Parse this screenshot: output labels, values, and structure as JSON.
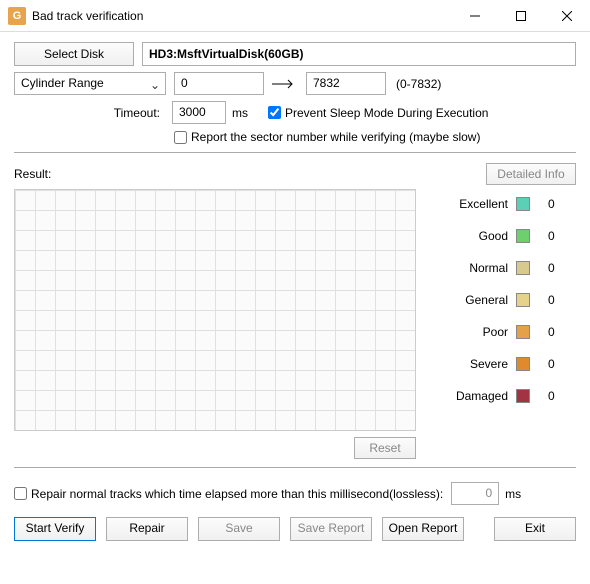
{
  "window": {
    "title": "Bad track verification",
    "icon_text": "G"
  },
  "toolbar": {
    "select_disk": "Select Disk",
    "disk_name": "HD3:MsftVirtualDisk(60GB)"
  },
  "range": {
    "mode_label": "Cylinder Range",
    "from": "0",
    "to": "7832",
    "hint": "(0-7832)"
  },
  "timeout": {
    "label": "Timeout:",
    "value": "3000",
    "unit": "ms"
  },
  "options": {
    "prevent_sleep": {
      "checked": true,
      "label": "Prevent Sleep Mode During Execution"
    },
    "report_sector": {
      "checked": false,
      "label": "Report the sector number while verifying (maybe slow)"
    }
  },
  "result": {
    "label": "Result:",
    "detailed_btn": "Detailed Info",
    "reset_btn": "Reset"
  },
  "legend": [
    {
      "label": "Excellent",
      "color": "#5bd0b7",
      "count": "0"
    },
    {
      "label": "Good",
      "color": "#6ecf6e",
      "count": "0"
    },
    {
      "label": "Normal",
      "color": "#d8c98e",
      "count": "0"
    },
    {
      "label": "General",
      "color": "#e6d28a",
      "count": "0"
    },
    {
      "label": "Poor",
      "color": "#e5a04a",
      "count": "0"
    },
    {
      "label": "Severe",
      "color": "#e08a2e",
      "count": "0"
    },
    {
      "label": "Damaged",
      "color": "#a23343",
      "count": "0"
    }
  ],
  "repair_ms": {
    "checked": false,
    "label": "Repair normal tracks which time elapsed more than this millisecond(lossless):",
    "value": "0",
    "unit": "ms"
  },
  "buttons": {
    "start_verify": "Start Verify",
    "repair": "Repair",
    "save": "Save",
    "save_report": "Save Report",
    "open_report": "Open Report",
    "exit": "Exit"
  }
}
